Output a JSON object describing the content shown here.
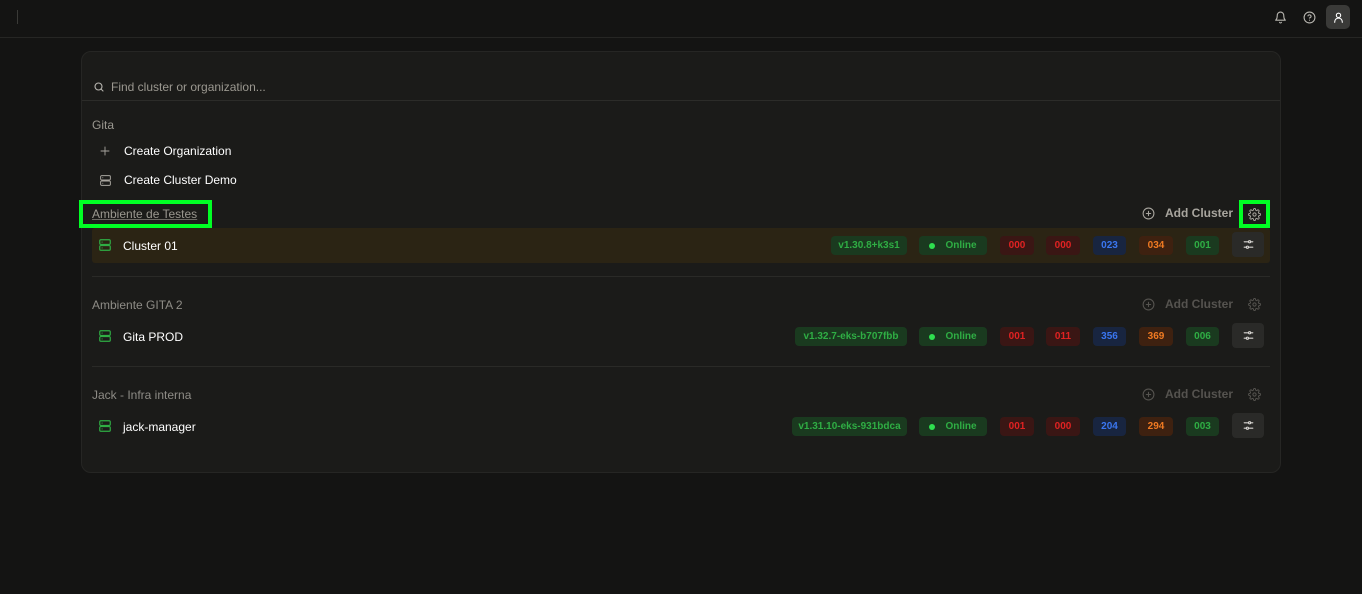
{
  "topbar": {
    "icons": [
      "bell-icon",
      "help-icon",
      "user-icon"
    ]
  },
  "search": {
    "placeholder": "Find cluster or organization..."
  },
  "commands": {
    "group_label": "Gita",
    "items": [
      {
        "label": "Create Organization",
        "icon": "plus-icon"
      },
      {
        "label": "Create Cluster Demo",
        "icon": "server-icon"
      }
    ]
  },
  "organizations": [
    {
      "name": "Ambiente de Testes",
      "add_cluster_label": "Add Cluster",
      "clusters": [
        {
          "name": "Cluster 01",
          "version": "v1.30.8+k3s1",
          "status": "Online",
          "counts": [
            "000",
            "000",
            "023",
            "034",
            "001"
          ]
        }
      ]
    },
    {
      "name": "Ambiente GITA 2",
      "add_cluster_label": "Add Cluster",
      "clusters": [
        {
          "name": "Gita PROD",
          "version": "v1.32.7-eks-b707fbb",
          "status": "Online",
          "counts": [
            "001",
            "011",
            "356",
            "369",
            "006"
          ]
        }
      ]
    },
    {
      "name": "Jack - Infra interna",
      "add_cluster_label": "Add Cluster",
      "clusters": [
        {
          "name": "jack-manager",
          "version": "v1.31.10-eks-931bdca",
          "status": "Online",
          "counts": [
            "001",
            "000",
            "204",
            "294",
            "003"
          ]
        }
      ]
    }
  ],
  "colors": {
    "highlight": "#00ff24",
    "online": "#2ee04f",
    "red": "#e02222",
    "blue": "#3a76f0",
    "orange": "#f07a22",
    "green": "#2fae44"
  }
}
